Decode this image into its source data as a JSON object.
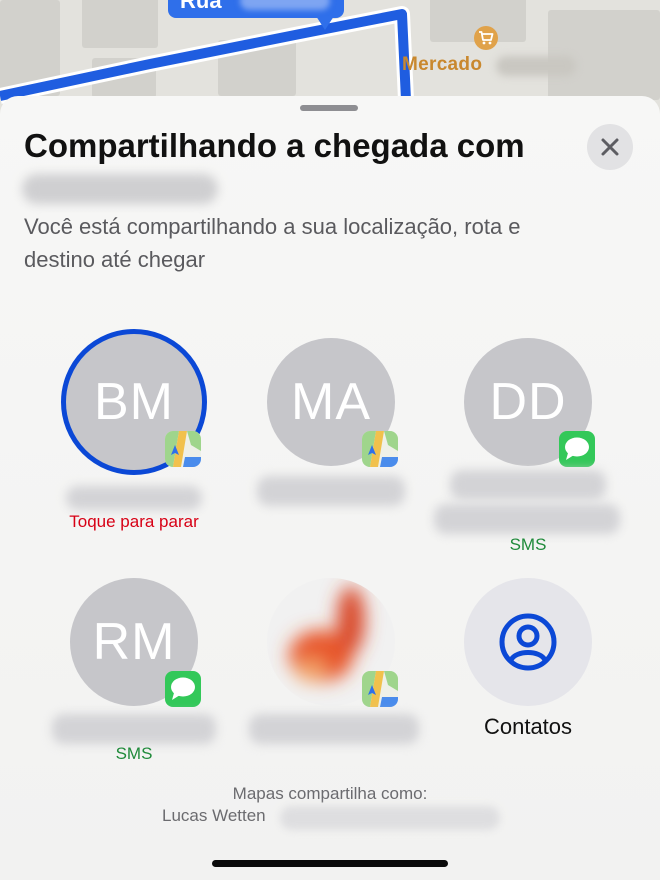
{
  "map": {
    "street_label": "Rua",
    "poi_label": "Mercado",
    "route_color": "#1f5de0"
  },
  "sheet": {
    "title": "Compartilhando a chegada com",
    "subtitle": "Você está compartilhando a sua localização, rota e destino até chegar",
    "close_icon": "xmark-icon"
  },
  "contacts": [
    {
      "initials": "BM",
      "app": "maps",
      "status": "Toque para parar",
      "status_type": "stop",
      "selected": true
    },
    {
      "initials": "MA",
      "app": "maps",
      "status": "",
      "status_type": "none",
      "selected": false
    },
    {
      "initials": "DD",
      "app": "messages",
      "status": "SMS",
      "status_type": "sms",
      "selected": false
    },
    {
      "initials": "RM",
      "app": "messages",
      "status": "SMS",
      "status_type": "sms",
      "selected": false
    },
    {
      "initials": "",
      "app": "maps",
      "status": "",
      "status_type": "none",
      "selected": false,
      "photo": true
    }
  ],
  "contacts_button": {
    "label": "Contatos",
    "icon": "person-circle-icon"
  },
  "footer": {
    "line1": "Mapas compartilha como:",
    "name": "Lucas Wetten"
  },
  "colors": {
    "accent": "#0b48d6",
    "stop": "#d70015",
    "sms": "#1f8a3a"
  }
}
